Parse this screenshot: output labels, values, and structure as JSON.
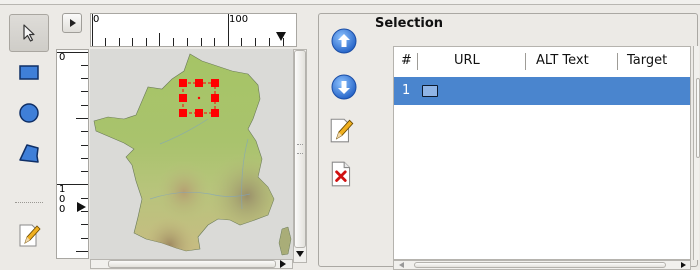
{
  "toolbar": {
    "tools": [
      {
        "name": "select-tool",
        "icon": "arrow-cursor-icon",
        "selected": true
      },
      {
        "name": "rectangle-tool",
        "icon": "rectangle-icon",
        "selected": false
      },
      {
        "name": "circle-tool",
        "icon": "circle-icon",
        "selected": false
      },
      {
        "name": "polygon-tool",
        "icon": "polygon-icon",
        "selected": false
      },
      {
        "name": "freehand-tool",
        "icon": "pencil-icon",
        "selected": false
      }
    ]
  },
  "editor": {
    "ruler_h_labels": [
      "0",
      "100"
    ],
    "ruler_v_labels": [
      "0",
      "1",
      "0",
      "0"
    ],
    "map_image": "france-relief-map",
    "selection_color": "#ff0000"
  },
  "panel": {
    "title": "Selection",
    "buttons": [
      {
        "name": "move-up-button",
        "icon": "arrow-up-circle-icon"
      },
      {
        "name": "move-down-button",
        "icon": "arrow-down-circle-icon"
      },
      {
        "name": "edit-area-button",
        "icon": "pencil-icon"
      },
      {
        "name": "delete-area-button",
        "icon": "delete-document-icon"
      }
    ],
    "columns": [
      "#",
      "URL",
      "ALT Text",
      "Target"
    ],
    "rows": [
      {
        "num": "1",
        "url": "",
        "alt": "",
        "target": "",
        "icon": "rectangle-icon",
        "selected": true
      }
    ]
  },
  "colors": {
    "selected_row": "#4a85ce",
    "accent_blue": "#2f6fd0"
  }
}
